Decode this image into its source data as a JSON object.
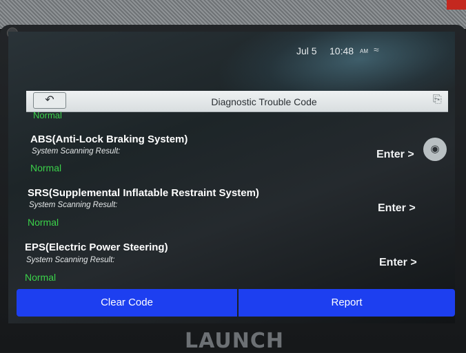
{
  "status_bar": {
    "date": "Jul 5",
    "time": "10:48",
    "ampm": "AM"
  },
  "header": {
    "title": "Diagnostic Trouble Code",
    "back_icon": "back-arrow-icon",
    "exit_icon": "exit-icon"
  },
  "previous_status": "Normal",
  "systems": [
    {
      "name": "ABS(Anti-Lock Braking System)",
      "scan_label": "System Scanning Result:",
      "result": "Normal",
      "enter": "Enter >"
    },
    {
      "name": "SRS(Supplemental Inflatable Restraint System)",
      "scan_label": "System Scanning Result:",
      "result": "Normal",
      "enter": "Enter >"
    },
    {
      "name": "EPS(Electric Power Steering)",
      "scan_label": "System Scanning Result:",
      "result": "Normal",
      "enter": "Enter >"
    }
  ],
  "buttons": {
    "clear": "Clear Code",
    "report": "Report"
  },
  "brand": "LAUNCH",
  "colors": {
    "normal": "#3bd24a",
    "action_bar": "#1d3ff0"
  }
}
